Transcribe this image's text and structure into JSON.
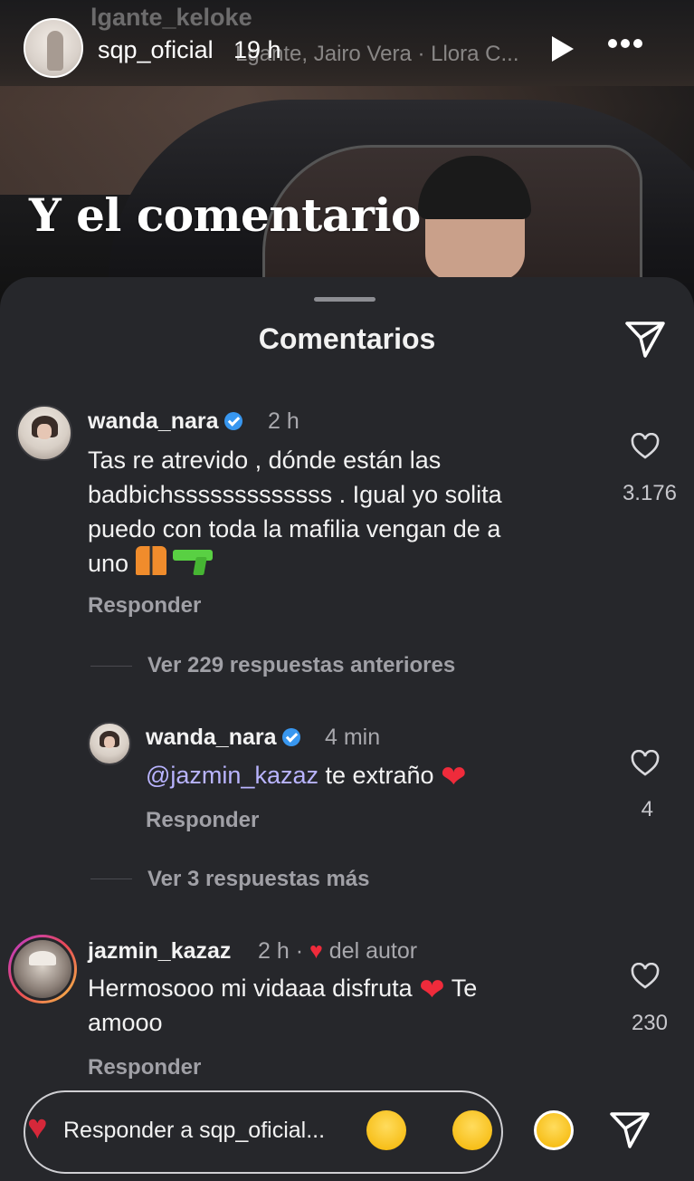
{
  "story": {
    "ghost_username": "lgante_keloke",
    "username": "sqp_oficial",
    "time": "19 h",
    "music": "Lgante, Jairo Vera · Llora C...",
    "overlay_text": "Y el comentario"
  },
  "sheet": {
    "title": "Comentarios"
  },
  "comments": [
    {
      "user": "wanda_nara",
      "time": "2 h",
      "text_line1": "Tas re atrevido , dónde están las",
      "text_line2": "badbichsssssssssssss . Igual yo solita",
      "text_line3": "puedo con toda la mafilia vengan de a",
      "text_line4": "uno",
      "likes": "3.176",
      "reply_label": "Responder"
    }
  ],
  "view_previous": "Ver 229 respuestas anteriores",
  "reply": {
    "user": "wanda_nara",
    "time": "4 min",
    "mention": "@jazmin_kazaz",
    "text": "te extraño",
    "likes": "4",
    "reply_label": "Responder"
  },
  "view_more": "Ver 3 respuestas más",
  "comment2": {
    "user": "jazmin_kazaz",
    "time": "2 h ·",
    "author_tag": "del autor",
    "text_line1": "Hermosooo mi vidaaa disfruta",
    "text_line1_end": "Te",
    "text_line2": "amooo",
    "likes": "230",
    "reply_label": "Responder"
  },
  "reply_bar": {
    "placeholder": "Responder a sqp_oficial..."
  },
  "icons": {
    "verified": "verified-icon",
    "heart": "heart-outline-icon",
    "send": "paper-plane-icon",
    "more": "more-dots-icon",
    "play": "play-icon"
  },
  "colors": {
    "sheet_bg": "#26272b",
    "verified": "#3897f0",
    "mention": "#b9b4ff",
    "red_heart": "#ef2b3b"
  }
}
